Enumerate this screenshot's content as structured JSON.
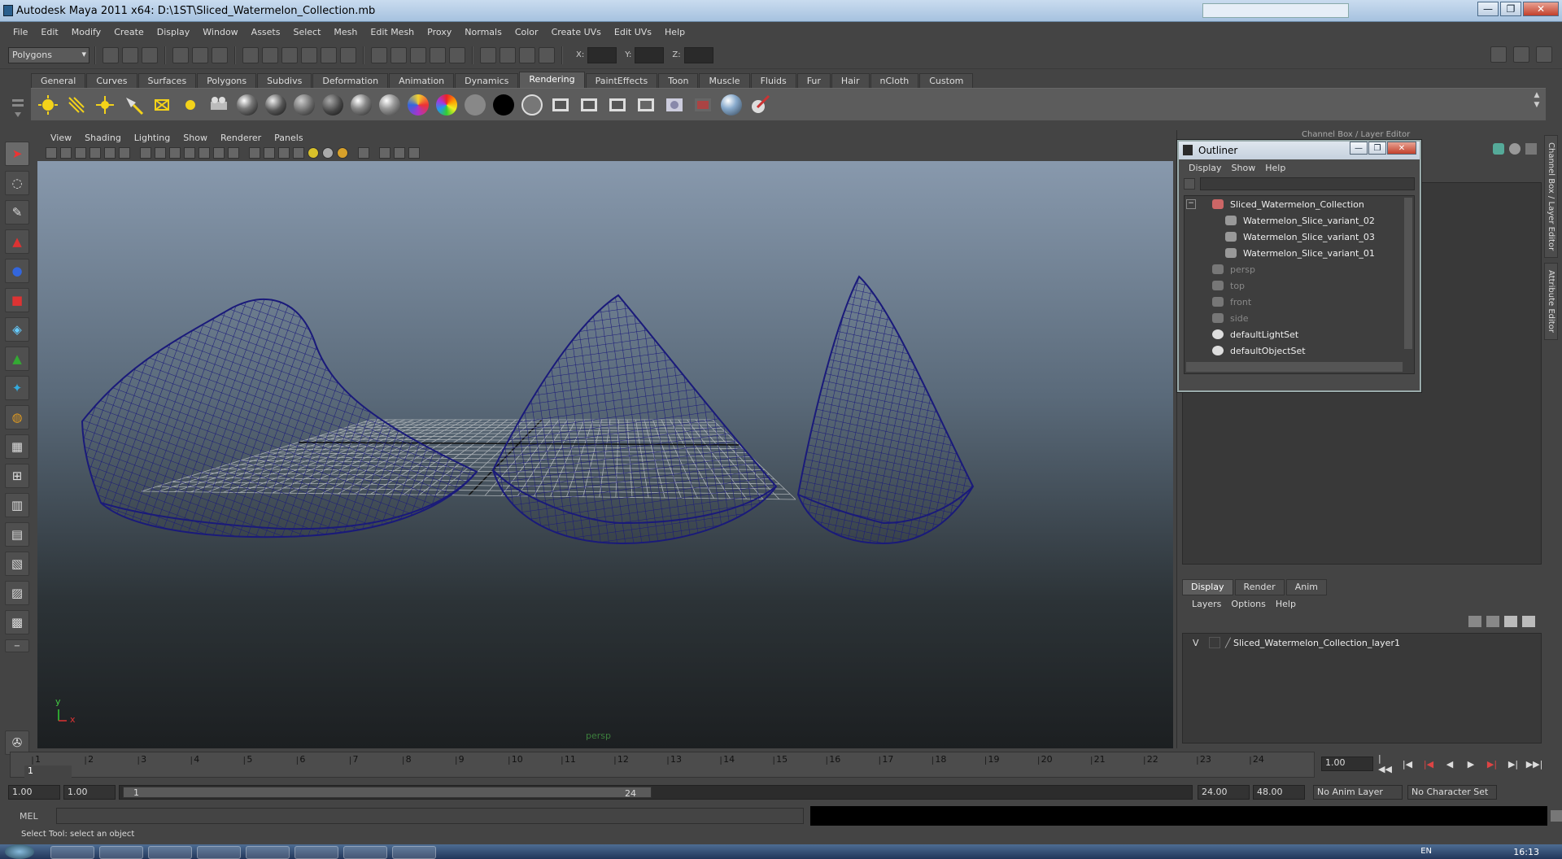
{
  "window": {
    "title": "Autodesk Maya 2011 x64: D:\\1ST\\Sliced_Watermelon_Collection.mb",
    "minimize": "—",
    "maximize": "❐",
    "close": "✕"
  },
  "menubar": [
    "File",
    "Edit",
    "Modify",
    "Create",
    "Display",
    "Window",
    "Assets",
    "Select",
    "Mesh",
    "Edit Mesh",
    "Proxy",
    "Normals",
    "Color",
    "Create UVs",
    "Edit UVs",
    "Help"
  ],
  "statusline": {
    "mode": "Polygons",
    "x_label": "X:",
    "y_label": "Y:",
    "z_label": "Z:"
  },
  "shelf": {
    "tabs": [
      "General",
      "Curves",
      "Surfaces",
      "Polygons",
      "Subdivs",
      "Deformation",
      "Animation",
      "Dynamics",
      "Rendering",
      "PaintEffects",
      "Toon",
      "Muscle",
      "Fluids",
      "Fur",
      "Hair",
      "nCloth",
      "Custom"
    ],
    "active_tab": "Rendering"
  },
  "viewport": {
    "menu": [
      "View",
      "Shading",
      "Lighting",
      "Show",
      "Renderer",
      "Panels"
    ],
    "camera_label": "persp",
    "axis_y": "y",
    "axis_x": "x",
    "wire_color": "#1a1a7a"
  },
  "channel_box": {
    "title": "Channel Box / Layer Editor",
    "side_tabs": [
      "Channel Box / Layer Editor",
      "Attribute Editor"
    ]
  },
  "outliner": {
    "title": "Outliner",
    "menu": [
      "Display",
      "Show",
      "Help"
    ],
    "collapse": "−",
    "items": [
      {
        "label": "Sliced_Watermelon_Collection",
        "indent": 0,
        "dim": false
      },
      {
        "label": "Watermelon_Slice_variant_02",
        "indent": 1,
        "dim": false
      },
      {
        "label": "Watermelon_Slice_variant_03",
        "indent": 1,
        "dim": false
      },
      {
        "label": "Watermelon_Slice_variant_01",
        "indent": 1,
        "dim": false
      },
      {
        "label": "persp",
        "indent": 0,
        "dim": true
      },
      {
        "label": "top",
        "indent": 0,
        "dim": true
      },
      {
        "label": "front",
        "indent": 0,
        "dim": true
      },
      {
        "label": "side",
        "indent": 0,
        "dim": true
      },
      {
        "label": "defaultLightSet",
        "indent": 0,
        "dim": false
      },
      {
        "label": "defaultObjectSet",
        "indent": 0,
        "dim": false
      }
    ]
  },
  "layer_editor": {
    "tabs": [
      "Display",
      "Render",
      "Anim"
    ],
    "active_tab": "Display",
    "menu": [
      "Layers",
      "Options",
      "Help"
    ],
    "layers": [
      {
        "visible": "V",
        "name": "Sliced_Watermelon_Collection_layer1"
      }
    ]
  },
  "timeline": {
    "ticks": [
      "1",
      "2",
      "3",
      "4",
      "5",
      "6",
      "7",
      "8",
      "9",
      "10",
      "11",
      "12",
      "13",
      "14",
      "15",
      "16",
      "17",
      "18",
      "19",
      "20",
      "21",
      "22",
      "23",
      "24"
    ],
    "current_frame": "1",
    "frame_field": "1.00"
  },
  "range": {
    "start": "1.00",
    "playback_start": "1.00",
    "slider_start": "1",
    "slider_end": "24",
    "playback_end": "24.00",
    "end": "48.00",
    "anim_layer": "No Anim Layer",
    "char_set": "No Character Set"
  },
  "mel": {
    "label": "MEL"
  },
  "help_line": "Select Tool: select an object",
  "taskbar": {
    "lang": "EN",
    "clock": "16:13"
  }
}
